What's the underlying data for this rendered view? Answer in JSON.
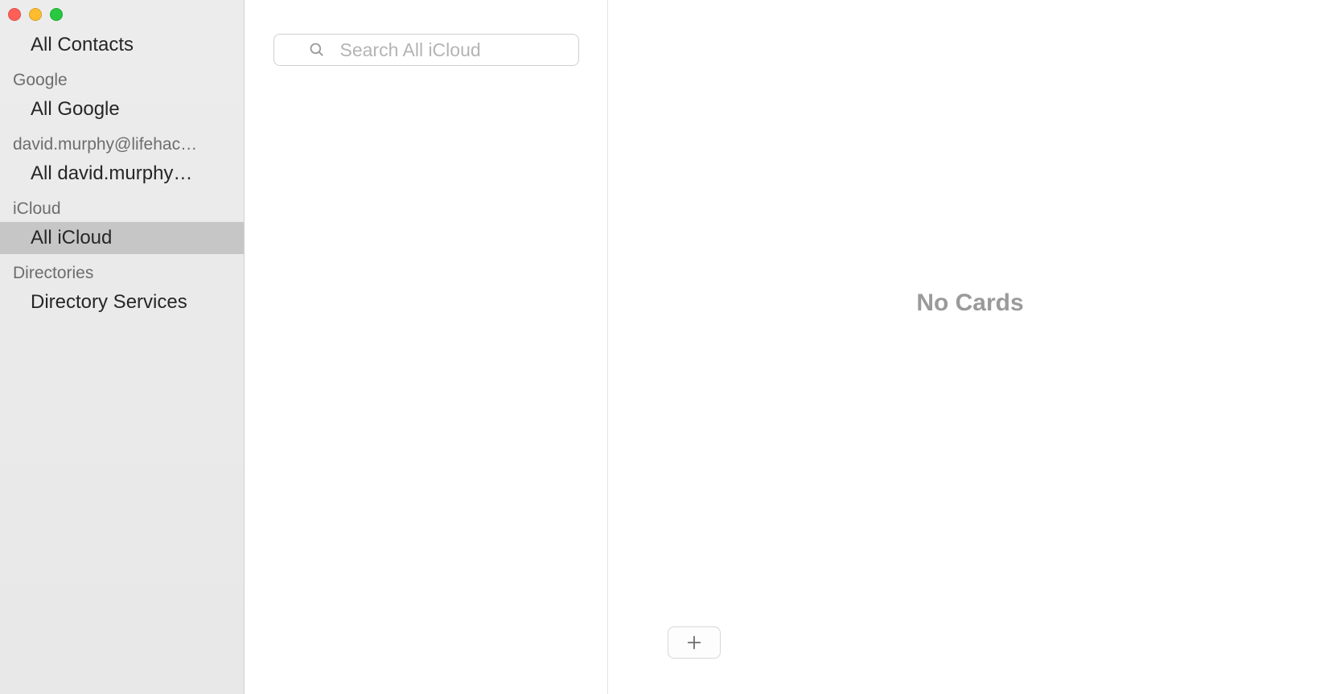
{
  "sidebar": {
    "top_item": "All Contacts",
    "sections": [
      {
        "header": "Google",
        "items": [
          "All Google"
        ]
      },
      {
        "header": "david.murphy@lifehac…",
        "items": [
          "All david.murphy…"
        ]
      },
      {
        "header": "iCloud",
        "items": [
          "All iCloud"
        ]
      },
      {
        "header": "Directories",
        "items": [
          "Directory Services"
        ]
      }
    ],
    "selected": "All iCloud"
  },
  "search": {
    "placeholder": "Search All iCloud",
    "value": ""
  },
  "detail": {
    "empty_label": "No Cards"
  },
  "colors": {
    "sidebar_bg": "#ececec",
    "selected_bg": "#c6c6c6",
    "section_header_text": "#6d6d6d",
    "placeholder_text": "#b4b4b4",
    "no_cards_text": "#9a9a9a"
  }
}
